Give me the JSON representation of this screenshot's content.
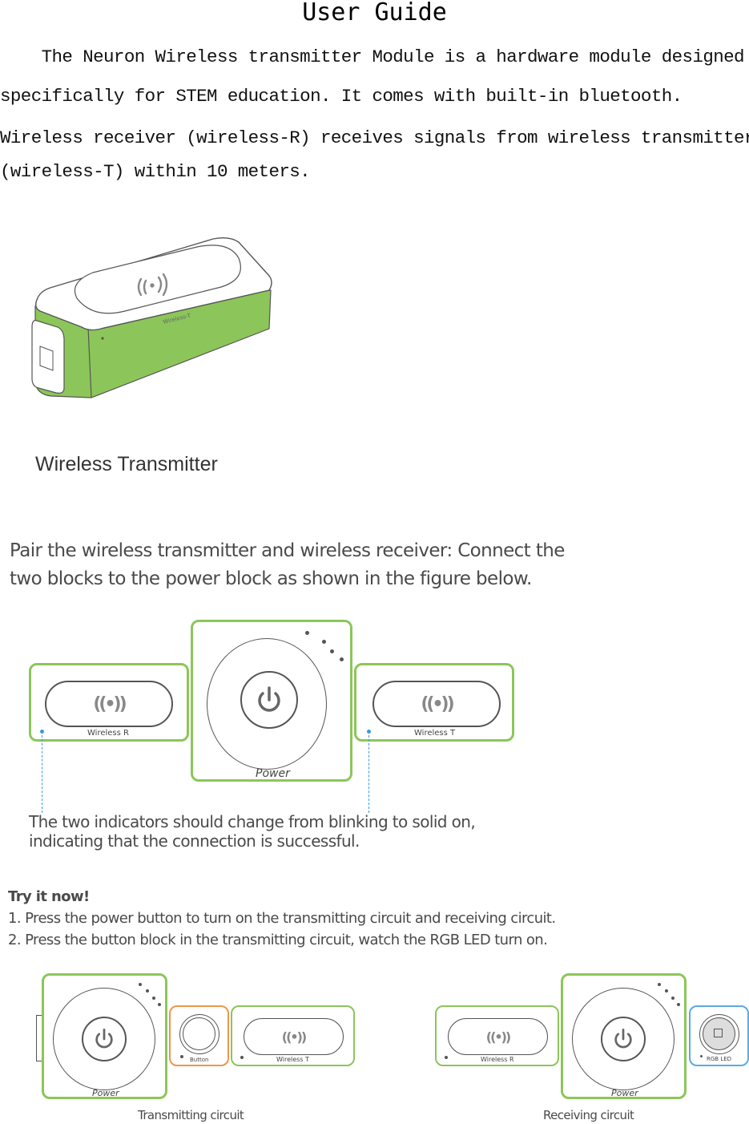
{
  "doc": {
    "title": "User Guide",
    "intro_lines": [
      "    The Neuron Wireless transmitter Module is a hardware module designed",
      "specifically for STEM education. It comes with built-in bluetooth.",
      "Wireless receiver (wireless-R) receives signals from wireless transmitter",
      "(wireless-T) within 10 meters."
    ]
  },
  "product": {
    "caption": "Wireless Transmitter",
    "device_label": "Wireless-T",
    "accent_color": "#8cc65a"
  },
  "pairing": {
    "instruction_lines": [
      "Pair the wireless transmitter and wireless receiver: Connect the",
      "two blocks to the power block as shown in the figure below."
    ],
    "blocks": {
      "left": "Wireless R",
      "center": "Power",
      "right": "Wireless T"
    },
    "note_lines": [
      "The two indicators should change from blinking to solid on,",
      "indicating that the connection is successful."
    ],
    "indicator_color": "#3a9ad9"
  },
  "try_it": {
    "heading": "Try it now!",
    "steps": [
      "1. Press the power button to turn on the transmitting circuit and receiving circuit.",
      "2. Press the button block in the transmitting circuit, watch the RGB LED turn on."
    ]
  },
  "circuits": {
    "transmitting": {
      "caption": "Transmitting circuit",
      "power_label": "Power",
      "button_label": "Button",
      "wireless_label": "Wireless T",
      "button_color": "#f0964a"
    },
    "receiving": {
      "caption": "Receiving circuit",
      "power_label": "Power",
      "wireless_label": "Wireless R",
      "led_label": "RGB LED",
      "led_color": "#5aace0"
    }
  }
}
